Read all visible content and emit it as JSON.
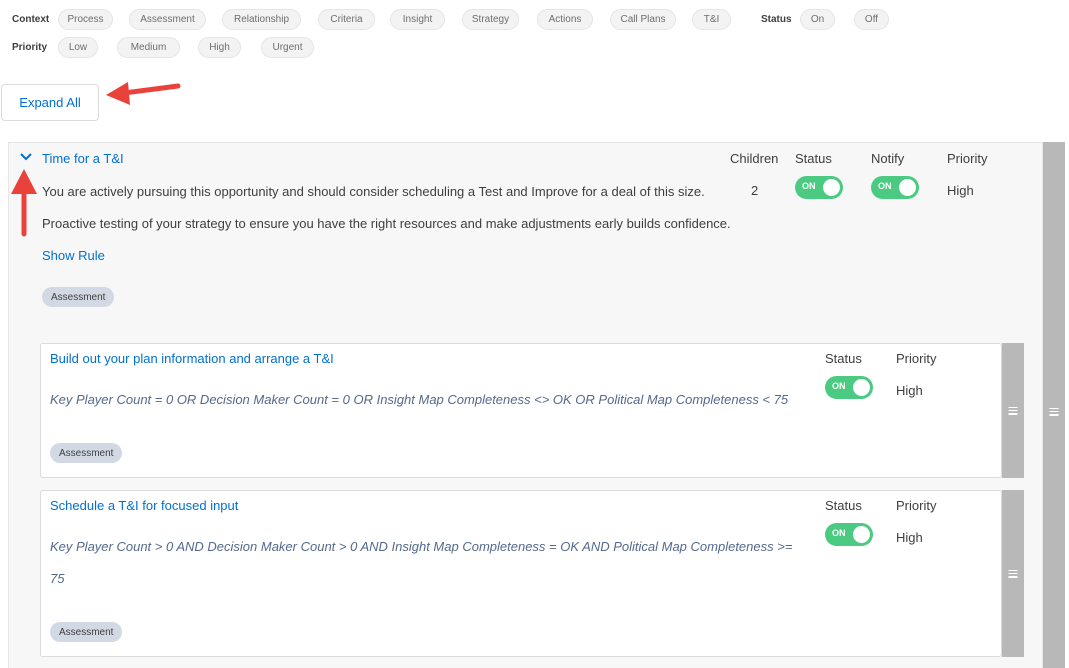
{
  "filters": {
    "context_label": "Context",
    "context": [
      "Process",
      "Assessment",
      "Relationship",
      "Criteria",
      "Insight",
      "Strategy",
      "Actions",
      "Call Plans",
      "T&I"
    ],
    "status_label": "Status",
    "status": [
      "On",
      "Off"
    ],
    "priority_label": "Priority",
    "priority": [
      "Low",
      "Medium",
      "High",
      "Urgent"
    ]
  },
  "expand_all_label": "Expand All",
  "main": {
    "title": "Time for a T&I",
    "col_children": "Children",
    "col_status": "Status",
    "col_notify": "Notify",
    "col_priority": "Priority",
    "description": "You are actively pursuing this opportunity and should consider scheduling a Test and Improve for a deal of this size.  Proactive testing of your strategy to ensure you have the right resources and make adjustments early builds confidence.",
    "show_rule_label": "Show Rule",
    "children_count": "2",
    "status_toggle": "ON",
    "notify_toggle": "ON",
    "priority": "High",
    "tag": "Assessment"
  },
  "children": [
    {
      "title": "Build out your plan information and arrange a T&I",
      "col_status": "Status",
      "col_priority": "Priority",
      "rule": "Key Player Count = 0 OR Decision Maker Count = 0 OR Insight Map Completeness <> OK OR Political Map Completeness < 75",
      "status_toggle": "ON",
      "priority": "High",
      "tag": "Assessment"
    },
    {
      "title": "Schedule a T&I for focused input",
      "col_status": "Status",
      "col_priority": "Priority",
      "rule": "Key Player Count > 0 AND Decision Maker Count > 0 AND Insight Map Completeness = OK AND Political Map Completeness >= 75",
      "status_toggle": "ON",
      "priority": "High",
      "tag": "Assessment"
    }
  ],
  "colors": {
    "link": "#0070d2",
    "toggle_on": "#4bca81",
    "annotation_arrow": "#e8423b",
    "drag_handle": "#b8b8b8"
  },
  "icons": {
    "expand_chevron": "chevron-down-icon",
    "drag_handle": "drag-handle-icon"
  }
}
